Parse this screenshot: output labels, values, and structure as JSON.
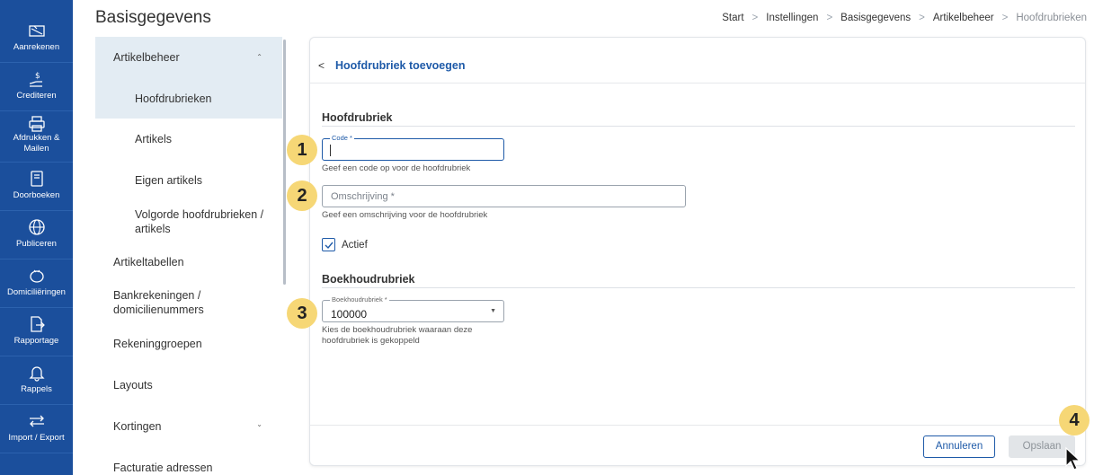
{
  "nav": {
    "items": [
      {
        "label": "Aanrekenen",
        "icon": "calculator-icon"
      },
      {
        "label": "Crediteren",
        "icon": "hand-money-icon"
      },
      {
        "label": "Afdrukken & Mailen",
        "icon": "printer-icon"
      },
      {
        "label": "Doorboeken",
        "icon": "book-icon"
      },
      {
        "label": "Publiceren",
        "icon": "globe-icon"
      },
      {
        "label": "Domiciliëringen",
        "icon": "piggy-bank-icon"
      },
      {
        "label": "Rapportage",
        "icon": "export-file-icon"
      },
      {
        "label": "Rappels",
        "icon": "bell-icon"
      },
      {
        "label": "Import / Export",
        "icon": "arrows-swap-icon"
      }
    ]
  },
  "header": {
    "title": "Basisgegevens",
    "breadcrumb": [
      "Start",
      "Instellingen",
      "Basisgegevens",
      "Artikelbeheer",
      "Hoofdrubrieken"
    ]
  },
  "subnav": {
    "items": [
      {
        "label": "Artikelbeheer"
      },
      {
        "label": "Hoofdrubrieken"
      },
      {
        "label": "Artikels"
      },
      {
        "label": "Eigen artikels"
      },
      {
        "label": "Volgorde hoofdrubrieken / artikels"
      },
      {
        "label": "Artikeltabellen"
      },
      {
        "label": "Bankrekeningen / domicilienummers"
      },
      {
        "label": "Rekeninggroepen"
      },
      {
        "label": "Layouts"
      },
      {
        "label": "Kortingen"
      },
      {
        "label": "Facturatie adressen"
      }
    ]
  },
  "form": {
    "title": "Hoofdrubriek toevoegen",
    "section1": "Hoofdrubriek",
    "code": {
      "label": "Code *",
      "value": "",
      "hint": "Geef een code op voor de hoofdrubriek"
    },
    "omschrijving": {
      "placeholder": "Omschrijving *",
      "hint": "Geef een omschrijving voor de hoofdrubriek"
    },
    "actief": {
      "label": "Actief",
      "checked": true
    },
    "section2": "Boekhoudrubriek",
    "boekhoudrubriek": {
      "label": "Boekhoudrubriek *",
      "value": "100000",
      "hint_line1": "Kies de boekhoudrubriek waaraan deze",
      "hint_line2": "hoofdrubriek is gekoppeld"
    },
    "cancel_label": "Annuleren",
    "save_label": "Opslaan"
  },
  "steps": [
    "1",
    "2",
    "3",
    "4"
  ],
  "colors": {
    "nav_bg": "#1b4f9c",
    "accent": "#1e5aa8",
    "step_marker": "#f6d776",
    "active_subnav": "#e3ecf3"
  }
}
